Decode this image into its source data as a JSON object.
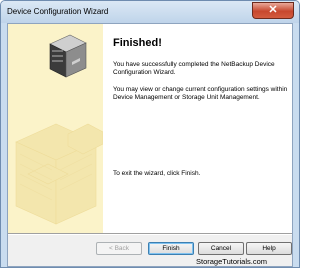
{
  "window": {
    "title": "Device Configuration Wizard",
    "close_glyph": "✕"
  },
  "content": {
    "heading": "Finished!",
    "paragraph1": "You have successfully completed the NetBackup Device Configuration Wizard.",
    "paragraph2": "You may view or change current configuration settings within Device Management or Storage Unit Management.",
    "exit_instruction": "To exit the wizard, click Finish."
  },
  "buttons": {
    "back": "< Back",
    "finish": "Finish",
    "cancel": "Cancel",
    "help": "Help"
  },
  "watermark": "StorageTutorials.com",
  "colors": {
    "side_panel": "#fbf3c9",
    "close_button": "#c7472e"
  },
  "icons": {
    "wizard_art": "server-tape-library-icon"
  }
}
